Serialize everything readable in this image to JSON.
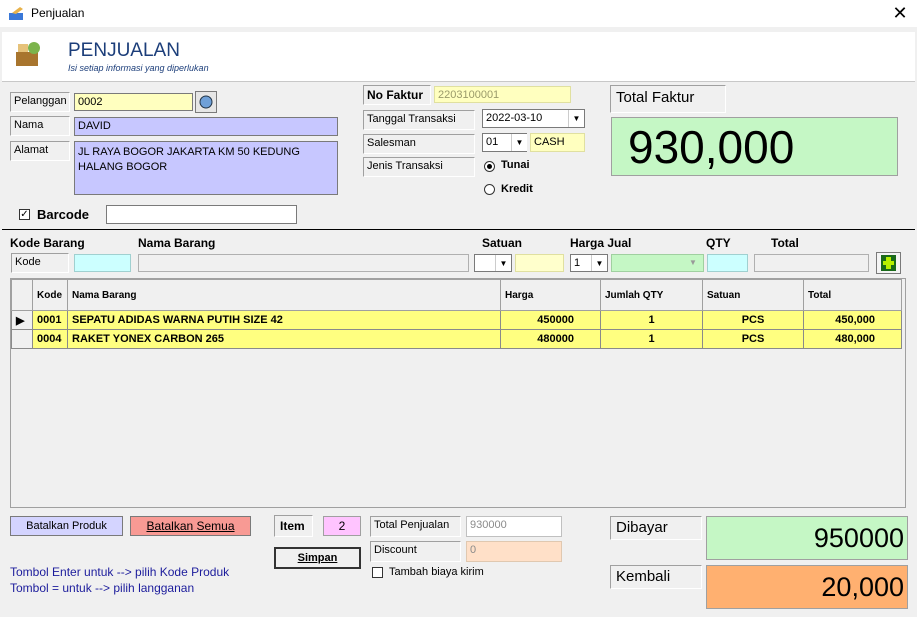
{
  "window": {
    "title": "Penjualan",
    "close": "✕"
  },
  "header": {
    "title": "PENJUALAN",
    "subtitle": "Isi setiap informasi yang diperlukan"
  },
  "customer": {
    "pelanggan_label": "Pelanggan",
    "pelanggan_value": "0002",
    "nama_label": "Nama",
    "nama_value": "DAVID",
    "alamat_label": "Alamat",
    "alamat_value": "JL RAYA BOGOR JAKARTA KM 50 KEDUNG HALANG BOGOR"
  },
  "barcode": {
    "label": "Barcode",
    "checked": true,
    "value": ""
  },
  "invoice": {
    "faktur_label": "No Faktur",
    "faktur_value": "2203100001",
    "tanggal_label": "Tanggal Transaksi",
    "tanggal_value": "2022-03-10",
    "salesman_label": "Salesman",
    "salesman_code": "01",
    "salesman_name": "CASH",
    "jenis_label": "Jenis Transaksi",
    "tunai_label": "Tunai",
    "kredit_label": "Kredit",
    "selected": "Tunai"
  },
  "total_faktur": {
    "label": "Total Faktur",
    "value": "930,000"
  },
  "entry": {
    "kode_header": "Kode Barang",
    "nama_header": "Nama Barang",
    "satuan_header": "Satuan",
    "harga_header": "Harga Jual",
    "qty_header": "QTY",
    "total_header": "Total",
    "kode_placeholder": "Kode",
    "qty_select": "1"
  },
  "table": {
    "columns": [
      "Kode",
      "Nama Barang",
      "Harga",
      "Jumlah QTY",
      "Satuan",
      "Total"
    ],
    "rows": [
      [
        "0001",
        "SEPATU ADIDAS WARNA PUTIH SIZE 42",
        "450000",
        "1",
        "PCS",
        "450,000"
      ],
      [
        "0004",
        "RAKET YONEX CARBON 265",
        "480000",
        "1",
        "PCS",
        "480,000"
      ]
    ]
  },
  "footer": {
    "batal_produk": "Batalkan Produk",
    "batal_semua": "Batalkan Semua",
    "item_label": "Item",
    "item_value": "2",
    "simpan": "Simpan",
    "total_penjualan_label": "Total Penjualan",
    "total_penjualan_value": "930000",
    "discount_label": "Discount",
    "discount_value": "0",
    "kirim_label": "Tambah biaya kirim",
    "note1": "Tombol Enter untuk --> pilih Kode Produk",
    "note2": "Tombol = untuk --> pilih langganan",
    "dibayar_label": "Dibayar",
    "dibayar_value": "950000",
    "kembali_label": "Kembali",
    "kembali_value": "20,000"
  }
}
